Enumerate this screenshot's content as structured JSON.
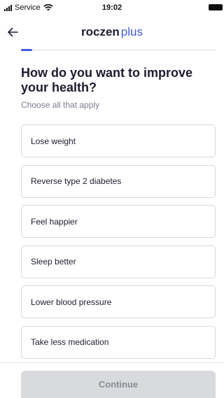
{
  "status_bar": {
    "carrier": "Service",
    "time": "19:02"
  },
  "header": {
    "logo_main": "roczen",
    "logo_plus": "plus",
    "back_icon": "arrow-left-icon"
  },
  "question": {
    "title": "How do you want to improve your health?",
    "subtitle": "Choose all that apply"
  },
  "options": [
    {
      "label": "Lose weight"
    },
    {
      "label": "Reverse type 2 diabetes"
    },
    {
      "label": "Feel happier"
    },
    {
      "label": "Sleep better"
    },
    {
      "label": "Lower blood pressure"
    },
    {
      "label": "Take less medication"
    }
  ],
  "footer": {
    "continue_label": "Continue"
  },
  "colors": {
    "brand_blue": "#3f5bdc",
    "text_dark": "#1c1c2e",
    "text_muted": "#7a7d8c",
    "border": "#d7d9e0",
    "button_disabled_bg": "#d9dade",
    "button_disabled_text": "#8a8c95"
  }
}
